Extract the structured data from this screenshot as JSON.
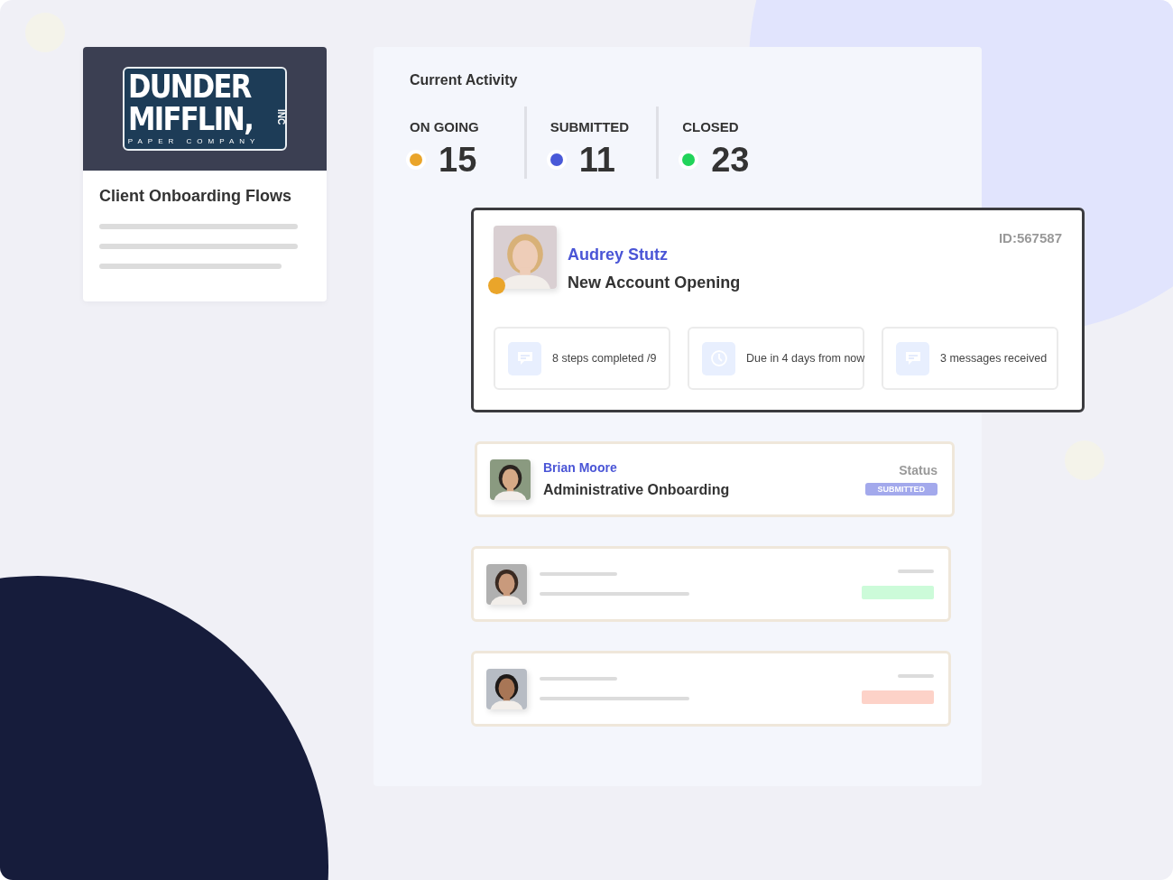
{
  "brand_card": {
    "logo": {
      "line_1": "DUNDER",
      "line_2": "MIFFLIN,",
      "suffix": "INC",
      "tagline": "PAPER COMPANY"
    },
    "title": "Client Onboarding Flows"
  },
  "activity": {
    "title": "Current Activity",
    "stats": [
      {
        "label": "ON GOING",
        "value": "15",
        "color": "#eaa52a"
      },
      {
        "label": "SUBMITTED",
        "value": "11",
        "color": "#4a5ad8"
      },
      {
        "label": "CLOSED",
        "value": "23",
        "color": "#22d45a"
      }
    ]
  },
  "featured": {
    "name": "Audrey Stutz",
    "flow": "New Account Opening",
    "id": "ID:567587",
    "color": "#eaa52a",
    "tiles": [
      {
        "kind": "chat",
        "text": "8 steps completed /9"
      },
      {
        "kind": "clock",
        "text": "Due in 4 days from now"
      },
      {
        "kind": "chat",
        "text": "3 messages received"
      }
    ]
  },
  "rows": [
    {
      "kind": "full",
      "name": "Brian Moore",
      "flow": "Administrative Onboarding",
      "status_label": "Status",
      "status": "SUBMITTED",
      "color": "#a3a9ec"
    },
    {
      "kind": "placeholder",
      "color": "#ccfbd9"
    },
    {
      "kind": "placeholder",
      "color": "#fdd2c8"
    }
  ]
}
